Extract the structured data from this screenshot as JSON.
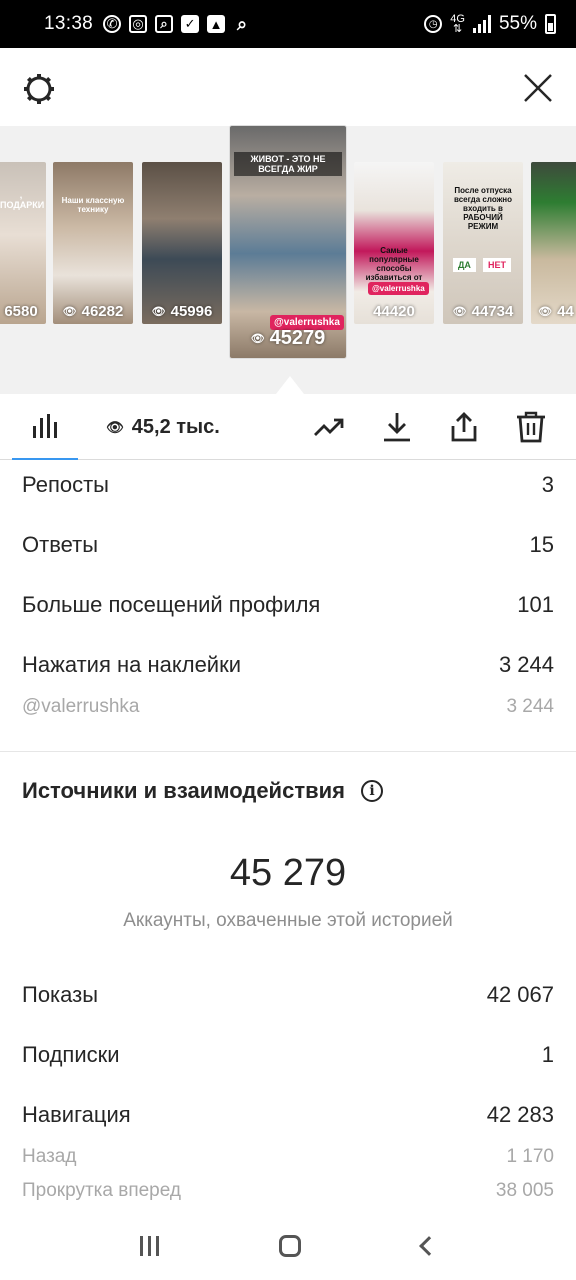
{
  "status_bar": {
    "time": "13:38",
    "network": "4G",
    "battery": "55%",
    "left_icons": [
      "whatsapp-icon",
      "instagram-icon",
      "search-app-icon",
      "check-icon",
      "image-icon",
      "search-icon"
    ],
    "right_icons": [
      "alarm-icon",
      "signal-icon",
      "battery-icon"
    ]
  },
  "header": {
    "left_icon": "gear-icon",
    "right_icon": "close-icon"
  },
  "stories": {
    "items": [
      {
        "views": "6580",
        "title": ", ПОДАРКИ"
      },
      {
        "views": "46282",
        "title": "Наши классную технику"
      },
      {
        "views": "45996",
        "title": ""
      },
      {
        "views": "45279",
        "title": "ЖИВОТ - ЭТО НЕ ВСЕГДА ЖИР",
        "tag": "@valerrushka",
        "selected": true
      },
      {
        "views": "44420",
        "title": "Самые популярные способы избавиться от живота",
        "tag": "@valerrushka"
      },
      {
        "views": "44734",
        "title": "После отпуска всегда сложно входить в РАБОЧИЙ РЕЖИМ",
        "poll_yes": "ДА",
        "poll_no": "НЕТ"
      },
      {
        "views": "44",
        "title": ""
      }
    ]
  },
  "toolbar": {
    "views_total": "45,2 тыс.",
    "icons": [
      "insights-bars-icon",
      "eye-icon",
      "trend-icon",
      "download-icon",
      "share-icon",
      "trash-icon"
    ]
  },
  "metrics": [
    {
      "label": "Репосты",
      "value": "3"
    },
    {
      "label": "Ответы",
      "value": "15"
    },
    {
      "label": "Больше посещений профиля",
      "value": "101"
    },
    {
      "label": "Нажатия на наклейки",
      "value": "3 244"
    }
  ],
  "sticker_detail": {
    "label": "@valerrushka",
    "value": "3 244"
  },
  "sources": {
    "title": "Источники и взаимодействия",
    "reach": "45 279",
    "reach_caption": "Аккаунты, охваченные этой историей",
    "rows": [
      {
        "label": "Показы",
        "value": "42 067"
      },
      {
        "label": "Подписки",
        "value": "1"
      },
      {
        "label": "Навигация",
        "value": "42 283"
      }
    ],
    "sub_rows": [
      {
        "label": "Назад",
        "value": "1 170"
      },
      {
        "label": "Прокрутка вперед",
        "value": "38 005"
      }
    ]
  },
  "colors": {
    "accent": "#3897f0",
    "text": "#262626",
    "secondary": "#8e8e8e",
    "tag": "#e0245e"
  }
}
